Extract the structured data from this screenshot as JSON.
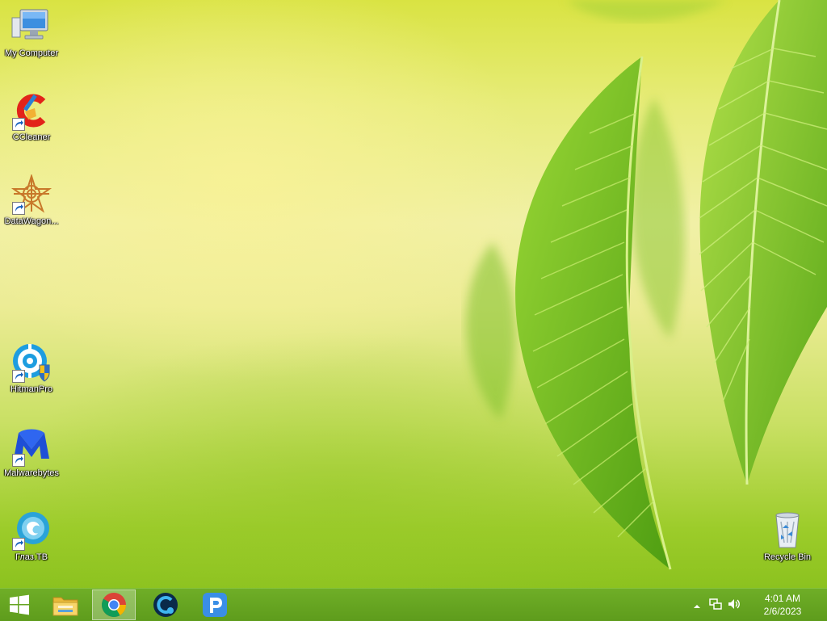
{
  "desktop": {
    "icons": [
      {
        "label": "My Computer",
        "icon": "computer-icon"
      },
      {
        "label": "CCleaner",
        "icon": "ccleaner-icon"
      },
      {
        "label": "DataWagon...",
        "icon": "datawagon-icon"
      },
      {
        "label": "HitmanPro",
        "icon": "hitmanpro-icon"
      },
      {
        "label": "Malwarebytes",
        "icon": "malwarebytes-icon"
      },
      {
        "label": "Глаз.ТВ",
        "icon": "glaz-tv-icon"
      },
      {
        "label": "Recycle Bin",
        "icon": "recycle-bin-icon"
      }
    ]
  },
  "taskbar": {
    "start": {
      "icon": "windows-logo-icon"
    },
    "pinned": [
      {
        "icon": "file-explorer-icon"
      },
      {
        "icon": "chrome-icon",
        "active": true
      },
      {
        "icon": "ccleaner-browser-icon"
      },
      {
        "icon": "pinterest-style-p-icon"
      }
    ],
    "tray": {
      "icons": [
        "show-hidden-icons-chevron",
        "network-icon",
        "volume-icon"
      ],
      "time": "4:01 AM",
      "date": "2/6/2023"
    }
  },
  "colors": {
    "taskbar": "#649f20",
    "wallpaper_light": "#f1f0a6",
    "wallpaper_green": "#8cc21f"
  }
}
